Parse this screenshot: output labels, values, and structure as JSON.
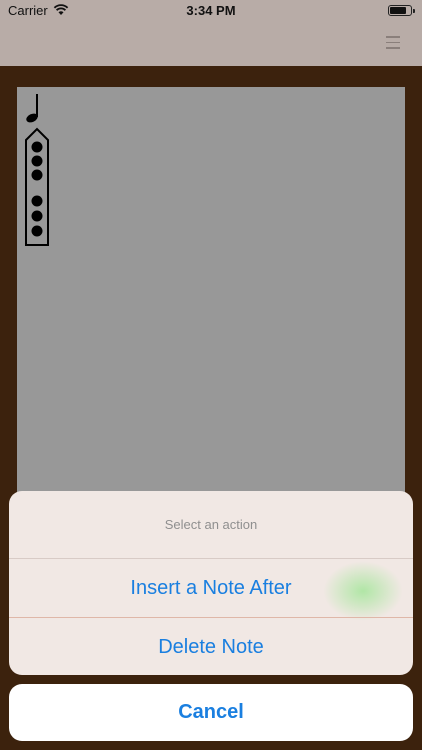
{
  "status_bar": {
    "carrier": "Carrier",
    "time": "3:34 PM",
    "wifi_icon": "wifi-icon",
    "battery_icon": "battery-icon"
  },
  "nav": {
    "menu_icon": "hamburger-menu-icon"
  },
  "canvas": {
    "note_icon": "quarter-note-icon",
    "fingering_icon": "flute-fingering-chart-icon",
    "holes_closed": 6,
    "holes_total": 6
  },
  "action_sheet": {
    "title": "Select an action",
    "actions": [
      {
        "label": "Insert a Note After"
      },
      {
        "label": "Delete Note"
      }
    ],
    "cancel_label": "Cancel"
  },
  "colors": {
    "frame": "#3c220d",
    "canvas": "#989898",
    "accent": "#1a7fe0"
  }
}
